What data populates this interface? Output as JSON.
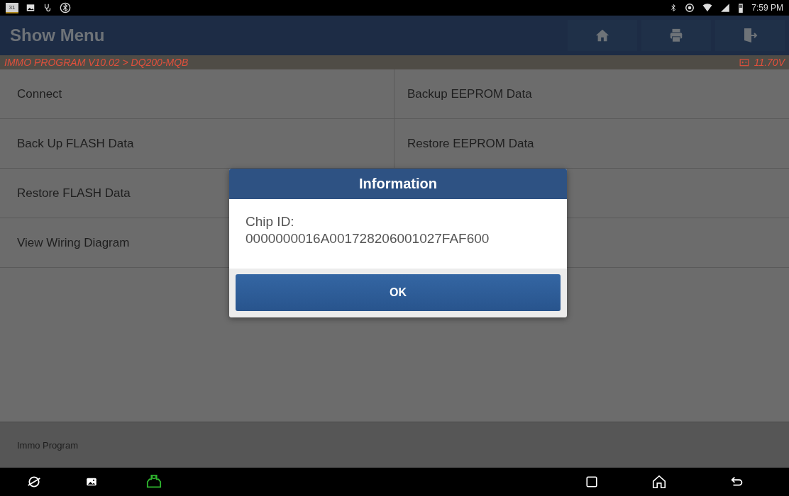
{
  "status_bar": {
    "calendar_day": "31",
    "time": "7:59 PM"
  },
  "header": {
    "title": "Show Menu"
  },
  "breadcrumb": {
    "path": "IMMO PROGRAM V10.02 > DQ200-MQB",
    "voltage": "11.70V"
  },
  "menu": {
    "left": [
      "Connect",
      "Back Up FLASH Data",
      "Restore FLASH Data",
      "View Wiring Diagram"
    ],
    "right": [
      "Backup EEPROM Data",
      "Restore EEPROM Data"
    ]
  },
  "footer": {
    "label": "Immo Program"
  },
  "dialog": {
    "title": "Information",
    "lines": [
      "Chip ID:",
      "0000000016A001728206001027FAF600"
    ],
    "button": "OK"
  }
}
